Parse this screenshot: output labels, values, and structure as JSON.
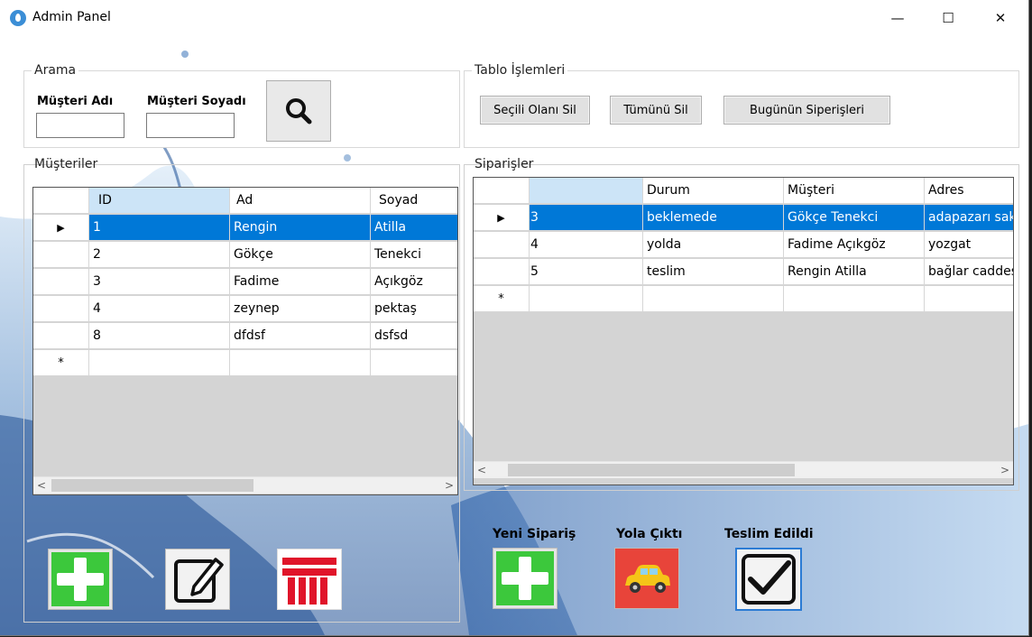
{
  "window": {
    "title": "Admin Panel",
    "minimize": "—",
    "maximize": "☐",
    "close": "✕"
  },
  "search": {
    "group_title": "Arama",
    "first_name_label": "Müşteri Adı",
    "last_name_label": "Müşteri Soyadı",
    "first_name_value": "",
    "last_name_value": ""
  },
  "table_ops": {
    "group_title": "Tablo İşlemleri",
    "delete_selected": "Seçili Olanı Sil",
    "delete_all": "Tümünü Sil",
    "todays_orders": "Bugünün Siperişleri"
  },
  "customers": {
    "group_title": "Müşteriler",
    "columns": [
      "ID",
      "Ad",
      "Soyad"
    ],
    "rows": [
      [
        "1",
        "Rengin",
        "Atilla"
      ],
      [
        "2",
        "Gökçe",
        "Tenekci"
      ],
      [
        "3",
        "Fadime",
        "Açıkgöz"
      ],
      [
        "4",
        "zeynep",
        "pektaş"
      ],
      [
        "8",
        "dfdsf",
        "dsfsd"
      ]
    ],
    "selected_row": 0,
    "new_row_marker": "*",
    "current_row_marker": "▶"
  },
  "orders": {
    "group_title": "Siparişler",
    "columns": [
      "",
      "Durum",
      "Müşteri",
      "Adres"
    ],
    "rows": [
      [
        "3",
        "beklemede",
        "Gökçe Tenekci",
        "adapazarı sakarya"
      ],
      [
        "4",
        "yolda",
        "Fadime Açıkgöz",
        "yozgat"
      ],
      [
        "5",
        "teslim",
        "Rengin Atilla",
        "bağlar caddesi"
      ]
    ],
    "selected_row": 0,
    "new_row_marker": "*",
    "current_row_marker": "▶"
  },
  "actions": {
    "new_order_label": "Yeni Sipariş",
    "on_the_way_label": "Yola Çıktı",
    "delivered_label": "Teslim Edildi"
  },
  "colors": {
    "selection": "#0078d7",
    "header_selected": "#cce4f7",
    "add_green": "#3cc83c",
    "delete_red": "#e0142a",
    "car_bg": "#e8443a"
  }
}
